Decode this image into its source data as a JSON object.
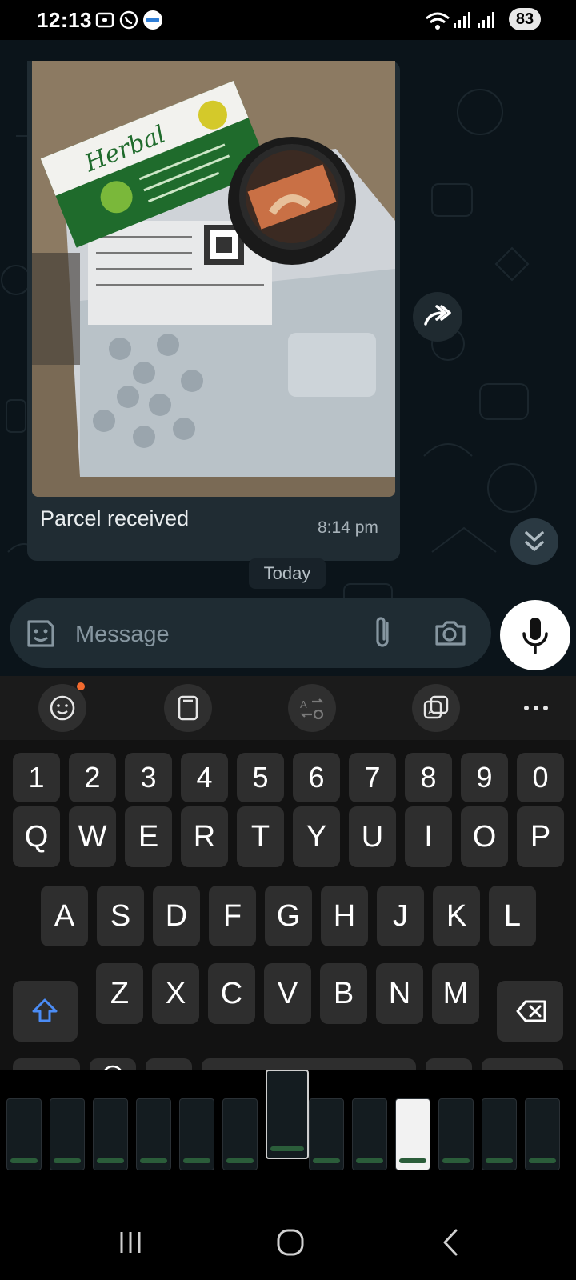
{
  "status_bar": {
    "time": "12:13",
    "battery": "83",
    "icons": [
      "screenshot-icon",
      "whatsapp-icon",
      "live-badge-icon",
      "wifi-icon",
      "signal-icon",
      "signal-icon-2"
    ]
  },
  "chat": {
    "message": {
      "caption": "Parcel received",
      "time": "8:14 pm"
    },
    "date_separator": "Today"
  },
  "input": {
    "placeholder": "Message"
  },
  "keyboard": {
    "toolbar": [
      "emoji-icon",
      "clipboard-icon",
      "translate-icon",
      "text-recognition-icon",
      "more-icon"
    ],
    "number_row": [
      "1",
      "2",
      "3",
      "4",
      "5",
      "6",
      "7",
      "8",
      "9",
      "0"
    ],
    "row1": [
      "Q",
      "W",
      "E",
      "R",
      "T",
      "Y",
      "U",
      "I",
      "O",
      "P"
    ],
    "row2": [
      "A",
      "S",
      "D",
      "F",
      "G",
      "H",
      "J",
      "K",
      "L"
    ],
    "row3": [
      "Z",
      "X",
      "C",
      "V",
      "B",
      "N",
      "M"
    ]
  },
  "colors": {
    "chat_bg": "#0b141a",
    "bubble": "#202c33",
    "accent_mic": "#ffffff",
    "shift_blue": "#4b8cf5",
    "notification_dot": "#f26a2e"
  }
}
